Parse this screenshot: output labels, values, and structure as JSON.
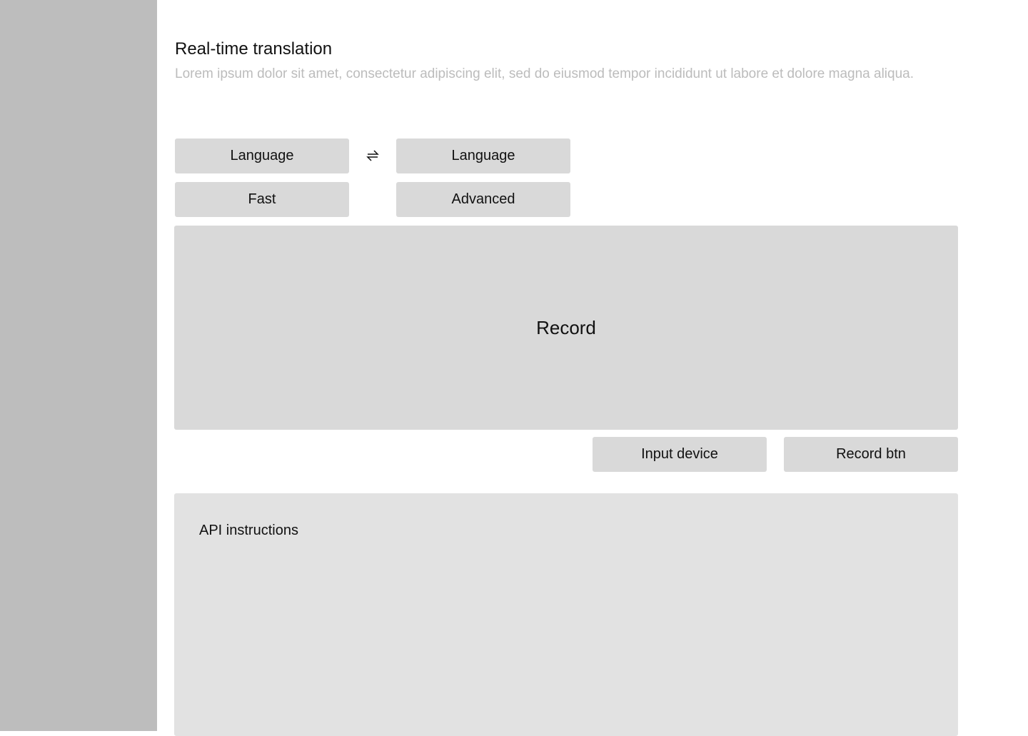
{
  "page": {
    "title": "Real-time translation",
    "description": "Lorem ipsum dolor sit amet, consectetur adipiscing elit, sed do eiusmod tempor incididunt ut labore et dolore magna aliqua."
  },
  "language_selector": {
    "source_label": "Language",
    "target_label": "Language",
    "swap_icon": "swap-arrows-icon"
  },
  "mode": {
    "fast_label": "Fast",
    "advanced_label": "Advanced"
  },
  "record_area": {
    "label": "Record"
  },
  "controls": {
    "input_device_label": "Input device",
    "record_button_label": "Record btn"
  },
  "api_panel": {
    "title": "API instructions"
  },
  "colors": {
    "sidebar": "#bdbdbd",
    "button": "#d9d9d9",
    "panel": "#e2e2e2",
    "muted_text": "#bcbcbc"
  }
}
